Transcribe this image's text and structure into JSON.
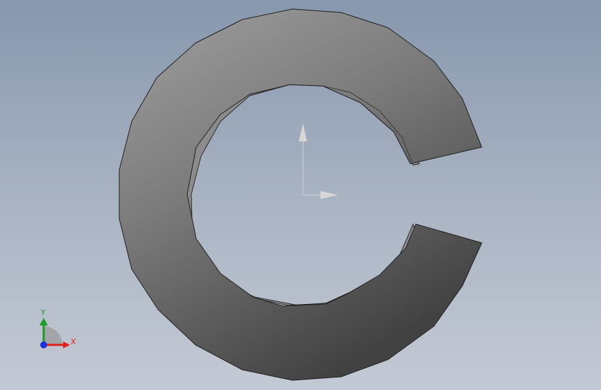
{
  "viewport": {
    "background_top": "#8797ad",
    "background_bottom": "#c4cad5"
  },
  "model": {
    "part": "snap-ring",
    "face_color_light": "#9b9b9b",
    "face_color_dark": "#454545",
    "edge_color": "#1e1e1e",
    "inner_wall_color": "#8d8d8d"
  },
  "origin_marker": {
    "color": "#d0d0d0"
  },
  "triad": {
    "x_label": "X",
    "y_label": "Y",
    "x_color": "#e0201c",
    "y_color": "#1f9a2a",
    "z_color": "#1d2fd6"
  }
}
